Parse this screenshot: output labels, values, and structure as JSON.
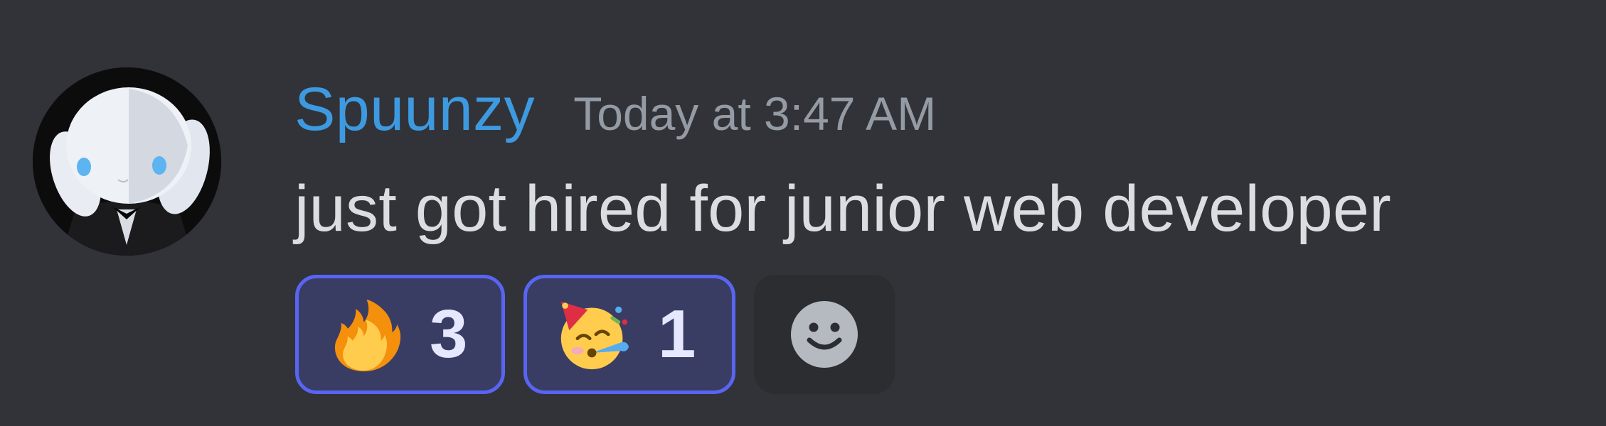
{
  "message": {
    "author": {
      "username": "Spuunzy",
      "username_color": "#3e9ae0",
      "avatar": "white-bunny-plush-avatar"
    },
    "timestamp": "Today at 3:47 AM",
    "content": "just got hired for junior web developer",
    "reactions": [
      {
        "emoji": "fire-emoji",
        "count": "3",
        "me": true
      },
      {
        "emoji": "partying-face-emoji",
        "count": "1",
        "me": true
      }
    ],
    "add_reaction_icon": "smiley-icon"
  },
  "colors": {
    "background": "#313338",
    "reaction_border": "#5865f2",
    "reaction_background": "#3a3d63",
    "add_reaction_background": "#2b2d31",
    "text": "#dbdee1",
    "timestamp": "#949ba4"
  }
}
